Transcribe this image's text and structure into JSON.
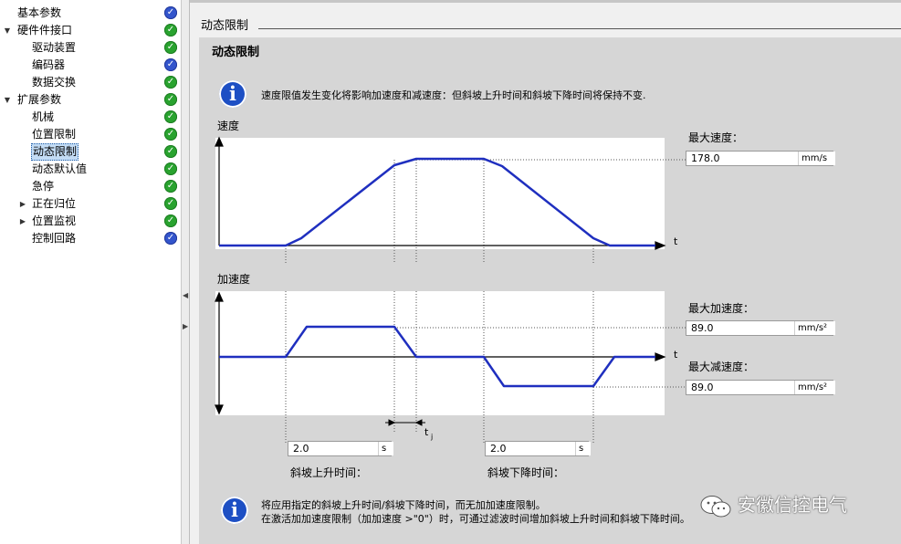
{
  "nav": {
    "items": [
      {
        "label": "基本参数",
        "indent": 0,
        "expander": "",
        "status": "info"
      },
      {
        "label": "硬件件接口",
        "indent": 0,
        "expander": "▼",
        "status": "ok"
      },
      {
        "label": "驱动装置",
        "indent": 2,
        "expander": "",
        "status": "ok"
      },
      {
        "label": "编码器",
        "indent": 2,
        "expander": "",
        "status": "info"
      },
      {
        "label": "数据交换",
        "indent": 2,
        "expander": "",
        "status": "ok"
      },
      {
        "label": "扩展参数",
        "indent": 0,
        "expander": "▼",
        "status": "ok"
      },
      {
        "label": "机械",
        "indent": 2,
        "expander": "",
        "status": "ok"
      },
      {
        "label": "位置限制",
        "indent": 2,
        "expander": "",
        "status": "ok"
      },
      {
        "label": "动态限制",
        "indent": 2,
        "expander": "",
        "status": "ok",
        "selected": true
      },
      {
        "label": "动态默认值",
        "indent": 2,
        "expander": "",
        "status": "ok"
      },
      {
        "label": "急停",
        "indent": 2,
        "expander": "",
        "status": "ok"
      },
      {
        "label": "正在归位",
        "indent": 2,
        "expander": "▶",
        "status": "ok"
      },
      {
        "label": "位置监视",
        "indent": 2,
        "expander": "▶",
        "status": "ok"
      },
      {
        "label": "控制回路",
        "indent": 2,
        "expander": "",
        "status": "info"
      }
    ],
    "status_icons": {
      "ok": "checkmark-icon",
      "info": "info-check-icon"
    }
  },
  "section": {
    "title": "动态限制"
  },
  "panel": {
    "title": "动态限制",
    "info_top": "速度限值发生变化将影响加速度和减速度：但斜坡上升时间和斜坡下降时间将保持不变.",
    "velocity_chart_label": "速度",
    "accel_chart_label": "加速度",
    "axis_t": "t",
    "tj_label": "t",
    "tj_sub": "j",
    "max_velocity": {
      "label": "最大速度：",
      "value": "178.0",
      "unit": "mm/s"
    },
    "max_acceleration": {
      "label": "最大加速度：",
      "value": "89.0",
      "unit": "mm/s²"
    },
    "max_deceleration": {
      "label": "最大减速度：",
      "value": "89.0",
      "unit": "mm/s²"
    },
    "ramp_up": {
      "label": "斜坡上升时间：",
      "value": "2.0",
      "unit": "s"
    },
    "ramp_down": {
      "label": "斜坡下降时间：",
      "value": "2.0",
      "unit": "s"
    },
    "info_bottom_line1": "将应用指定的斜坡上升时间/斜坡下降时间，而无加加速度限制。",
    "info_bottom_line2": "在激活加加速度限制（加加速度 >\"0\"）时，可通过滤波时间增加斜坡上升时间和斜坡下降时间。"
  },
  "watermark": {
    "text": "安徽信控电气",
    "icon": "wechat-icon"
  },
  "colors": {
    "curve": "#1f2fbf",
    "panel_bg": "#d6d6d6",
    "ok": "#29a32f",
    "info": "#3355cc"
  }
}
